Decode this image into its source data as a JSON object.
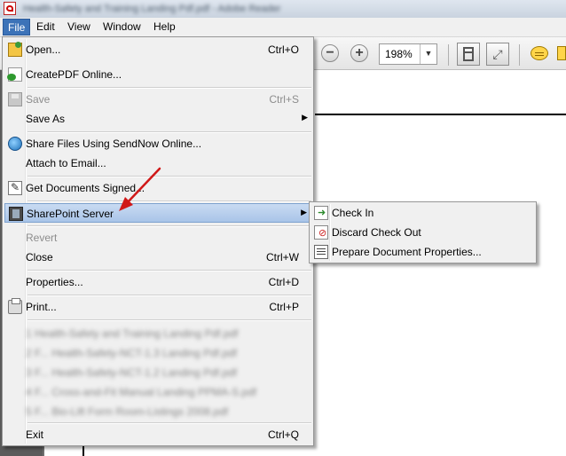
{
  "window": {
    "title": "Health-Safety and Training Landing Pdf.pdf - Adobe Reader"
  },
  "menubar": {
    "items": [
      "File",
      "Edit",
      "View",
      "Window",
      "Help"
    ]
  },
  "toolbar": {
    "zoom_value": "198%",
    "zoom_out_icon": "minus-icon",
    "zoom_in_icon": "plus-icon"
  },
  "file_menu": {
    "items": [
      {
        "label": "Open...",
        "shortcut": "Ctrl+O",
        "icon": "open-icon",
        "disabled": false
      },
      {
        "label": "CreatePDF Online...",
        "shortcut": "",
        "icon": "createpdf-icon",
        "disabled": false
      },
      {
        "label": "Save",
        "shortcut": "Ctrl+S",
        "icon": "save-icon",
        "disabled": true
      },
      {
        "label": "Save As",
        "shortcut": "",
        "icon": "",
        "disabled": false,
        "submenu": true
      },
      {
        "label": "Share Files Using SendNow Online...",
        "shortcut": "",
        "icon": "share-icon",
        "disabled": false
      },
      {
        "label": "Attach to Email...",
        "shortcut": "",
        "icon": "",
        "disabled": false
      },
      {
        "label": "Get Documents Signed...",
        "shortcut": "",
        "icon": "sign-icon",
        "disabled": false
      },
      {
        "label": "SharePoint Server",
        "shortcut": "",
        "icon": "sharepoint-icon",
        "disabled": false,
        "submenu": true,
        "highlighted": true
      },
      {
        "label": "Revert",
        "shortcut": "",
        "icon": "",
        "disabled": true
      },
      {
        "label": "Close",
        "shortcut": "Ctrl+W",
        "icon": "",
        "disabled": false
      },
      {
        "label": "Properties...",
        "shortcut": "Ctrl+D",
        "icon": "",
        "disabled": false
      },
      {
        "label": "Print...",
        "shortcut": "Ctrl+P",
        "icon": "print-icon",
        "disabled": false
      },
      {
        "label": "Exit",
        "shortcut": "Ctrl+Q",
        "icon": "",
        "disabled": false
      }
    ],
    "recent_files": [
      "1 Health-Safety and Training Landing Pdf.pdf",
      "2 F... Health-Safety-NCT-1.3 Landing Pdf.pdf",
      "3 F... Health-Safety-NCT-1.2 Landing Pdf.pdf",
      "4 F... Cross-and-Fit Manual Landing PPMA-S.pdf",
      "5 F... Bio-Lift Form Room-Listings 2008.pdf"
    ]
  },
  "sharepoint_submenu": {
    "items": [
      {
        "label": "Check In",
        "icon": "check-in-icon"
      },
      {
        "label": "Discard Check Out",
        "icon": "discard-checkout-icon"
      },
      {
        "label": "Prepare Document Properties...",
        "icon": "document-properties-icon"
      }
    ]
  },
  "colors": {
    "menu_highlight": "#3c73b8",
    "annotation_arrow": "#d01818",
    "menu_background": "#f0f0f0"
  }
}
